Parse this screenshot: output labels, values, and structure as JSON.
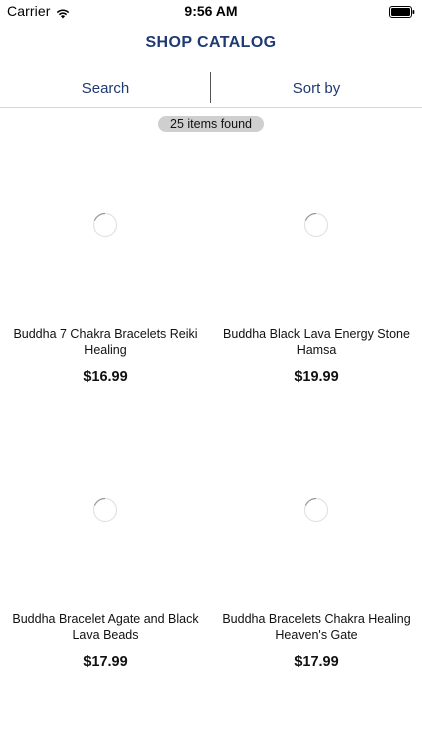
{
  "status_bar": {
    "carrier": "Carrier",
    "time": "9:56 AM",
    "wifi_icon": "wifi-icon",
    "battery_icon": "battery-icon"
  },
  "nav": {
    "title": "SHOP CATALOG",
    "title_color": "#1f3a73"
  },
  "toolbar": {
    "search_label": "Search",
    "sort_label": "Sort by",
    "accent_color": "#1f3a73"
  },
  "results": {
    "count_text": "25 items found"
  },
  "products": [
    {
      "title": "Buddha 7 Chakra Bracelets Reiki Healing",
      "price": "$16.99",
      "image_icon": "loading-spinner-icon"
    },
    {
      "title": "Buddha Black Lava Energy Stone Hamsa",
      "price": "$19.99",
      "image_icon": "loading-spinner-icon"
    },
    {
      "title": "Buddha Bracelet Agate and Black Lava Beads",
      "price": "$17.99",
      "image_icon": "loading-spinner-icon"
    },
    {
      "title": "Buddha Bracelets Chakra Healing Heaven's Gate",
      "price": "$17.99",
      "image_icon": "loading-spinner-icon"
    }
  ]
}
